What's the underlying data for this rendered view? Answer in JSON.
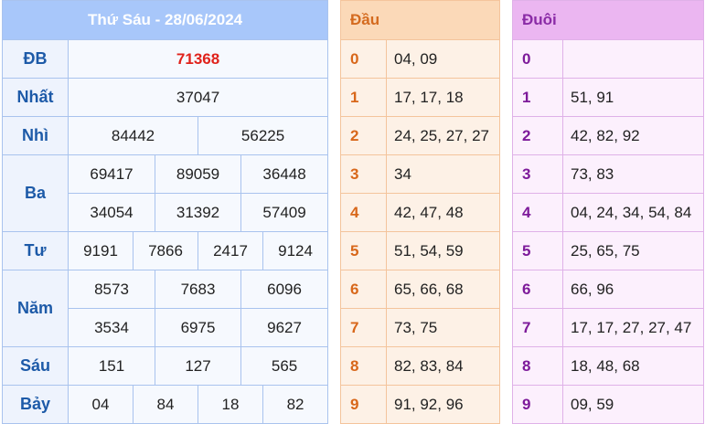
{
  "results": {
    "title": "Thứ Sáu - 28/06/2024",
    "prizes": {
      "db": {
        "label": "ĐB",
        "values": [
          "71368"
        ]
      },
      "nhat": {
        "label": "Nhất",
        "values": [
          "37047"
        ]
      },
      "nhi": {
        "label": "Nhì",
        "values": [
          "84442",
          "56225"
        ]
      },
      "ba": {
        "label": "Ba",
        "values": [
          "69417",
          "89059",
          "36448",
          "34054",
          "31392",
          "57409"
        ]
      },
      "tu": {
        "label": "Tư",
        "values": [
          "9191",
          "7866",
          "2417",
          "9124"
        ]
      },
      "nam": {
        "label": "Năm",
        "values": [
          "8573",
          "7683",
          "6096",
          "3534",
          "6975",
          "9627"
        ]
      },
      "sau": {
        "label": "Sáu",
        "values": [
          "151",
          "127",
          "565"
        ]
      },
      "bay": {
        "label": "Bảy",
        "values": [
          "04",
          "84",
          "18",
          "82"
        ]
      }
    },
    "special_color": "#e0221b"
  },
  "dau": {
    "header": "Đầu",
    "rows": [
      {
        "digit": "0",
        "list": "04, 09"
      },
      {
        "digit": "1",
        "list": "17, 17, 18"
      },
      {
        "digit": "2",
        "list": "24, 25, 27, 27"
      },
      {
        "digit": "3",
        "list": "34"
      },
      {
        "digit": "4",
        "list": "42, 47, 48"
      },
      {
        "digit": "5",
        "list": "51, 54, 59"
      },
      {
        "digit": "6",
        "list": "65, 66, 68"
      },
      {
        "digit": "7",
        "list": "73, 75"
      },
      {
        "digit": "8",
        "list": "82, 83, 84"
      },
      {
        "digit": "9",
        "list": "91, 92, 96"
      }
    ]
  },
  "duoi": {
    "header": "Đuôi",
    "rows": [
      {
        "digit": "0",
        "list": ""
      },
      {
        "digit": "1",
        "list": "51, 91"
      },
      {
        "digit": "2",
        "list": "42, 82, 92"
      },
      {
        "digit": "3",
        "list": "73, 83"
      },
      {
        "digit": "4",
        "list": "04, 24, 34, 54, 84"
      },
      {
        "digit": "5",
        "list": "25, 65, 75"
      },
      {
        "digit": "6",
        "list": "66, 96"
      },
      {
        "digit": "7",
        "list": "17, 17, 27, 27, 47"
      },
      {
        "digit": "8",
        "list": "18, 48, 68"
      },
      {
        "digit": "9",
        "list": "09, 59"
      }
    ]
  }
}
